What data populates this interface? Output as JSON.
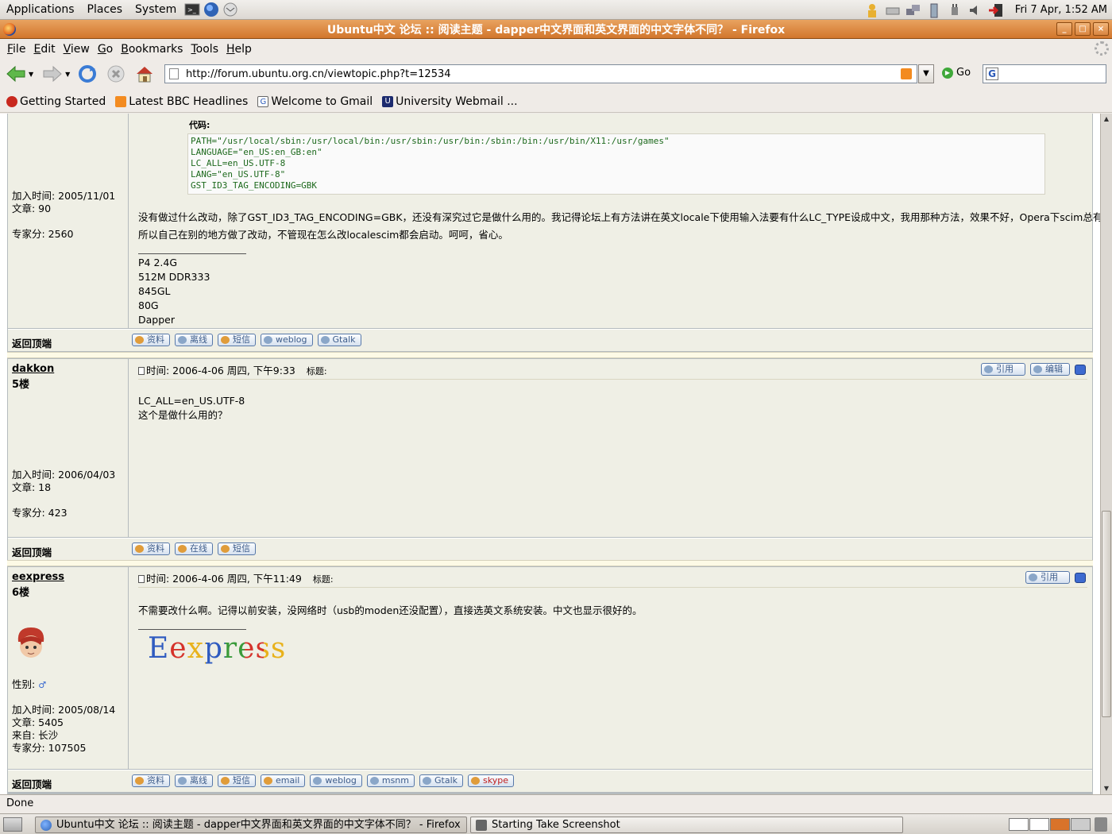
{
  "panel": {
    "menus": [
      "Applications",
      "Places",
      "System"
    ],
    "clock": "Fri  7 Apr,  1:52 AM"
  },
  "window": {
    "title": "Ubuntu中文 论坛 :: 阅读主题 - dapper中文界面和英文界面的中文字体不同？ - Firefox",
    "controls": [
      "_",
      "□",
      "×"
    ]
  },
  "menubar": [
    "File",
    "Edit",
    "View",
    "Go",
    "Bookmarks",
    "Tools",
    "Help"
  ],
  "nav": {
    "url": "http://forum.ubuntu.org.cn/viewtopic.php?t=12534",
    "go_label": "Go",
    "search_value": ""
  },
  "bookmarks": [
    "Getting Started",
    "Latest BBC Headlines",
    "Welcome to Gmail",
    "University Webmail ..."
  ],
  "post1": {
    "code_label": "代码:",
    "code_lines": [
      "PATH=\"/usr/local/sbin:/usr/local/bin:/usr/sbin:/usr/bin:/sbin:/bin:/usr/bin/X11:/usr/games\"",
      "LANGUAGE=\"en_US:en_GB:en\"",
      "LC_ALL=en_US.UTF-8",
      "LANG=\"en_US.UTF-8\"",
      "GST_ID3_TAG_ENCODING=GBK"
    ],
    "joined": "加入时间: 2005/11/01",
    "posts": "文章: 90",
    "score": "专家分: 2560",
    "text_line1": "没有做过什么改动，除了GST_ID3_TAG_ENCODING=GBK，还没有深究过它是做什么用的。我记得论坛上有方法讲在英文locale下使用输入法要有什么LC_TYPE设成中文，我用那种方法，效果不好，Opera下scim总有问题，",
    "text_line2": "所以自己在别的地方做了改动，不管现在怎么改localescim都会启动。呵呵，省心。",
    "sig": [
      "P4 2.4G",
      "512M DDR333",
      "845GL",
      "80G",
      "Dapper"
    ],
    "back_top": "返回顶端",
    "buttons": [
      "资料",
      "离线",
      "短信",
      "weblog",
      "Gtalk"
    ]
  },
  "post2": {
    "username": "dakkon",
    "floor": "5楼",
    "time": "时间: 2006-4-06 周四, 下午9:33",
    "subject": "标题:",
    "quote_btn": "引用",
    "edit_btn": "编辑",
    "body_line1": "LC_ALL=en_US.UTF-8",
    "body_line2": "这个是做什么用的？",
    "joined": "加入时间: 2006/04/03",
    "posts": "文章: 18",
    "score": "专家分: 423",
    "back_top": "返回顶端",
    "buttons": [
      "资料",
      "在线",
      "短信"
    ]
  },
  "post3": {
    "username": "eexpress",
    "floor": "6楼",
    "time": "时间: 2006-4-06 周四, 下午11:49",
    "subject": "标题:",
    "quote_btn": "引用",
    "body": "不需要改什么啊。记得以前安装，没网络时（usb的moden还没配置），直接选英文系统安装。中文也显示很好的。",
    "sig_logo": "Eexpress",
    "gender": "性别:",
    "joined": "加入时间: 2005/08/14",
    "posts": "文章: 5405",
    "location": "来自: 长沙",
    "score": "专家分: 107505",
    "back_top": "返回顶端",
    "buttons": [
      "资料",
      "离线",
      "短信",
      "email",
      "weblog",
      "msnm",
      "Gtalk",
      "skype"
    ]
  },
  "status": "Done",
  "taskbar": {
    "task1": "Ubuntu中文 论坛 :: 阅读主题 - dapper中文界面和英文界面的中文字体不同？ - Firefox",
    "task2": "Starting Take Screenshot"
  },
  "colors": {
    "titlebar": "#d2762c",
    "post_bg": "#efefe5",
    "separator": "#fdfae6",
    "button_text": "#3d5c8a"
  }
}
